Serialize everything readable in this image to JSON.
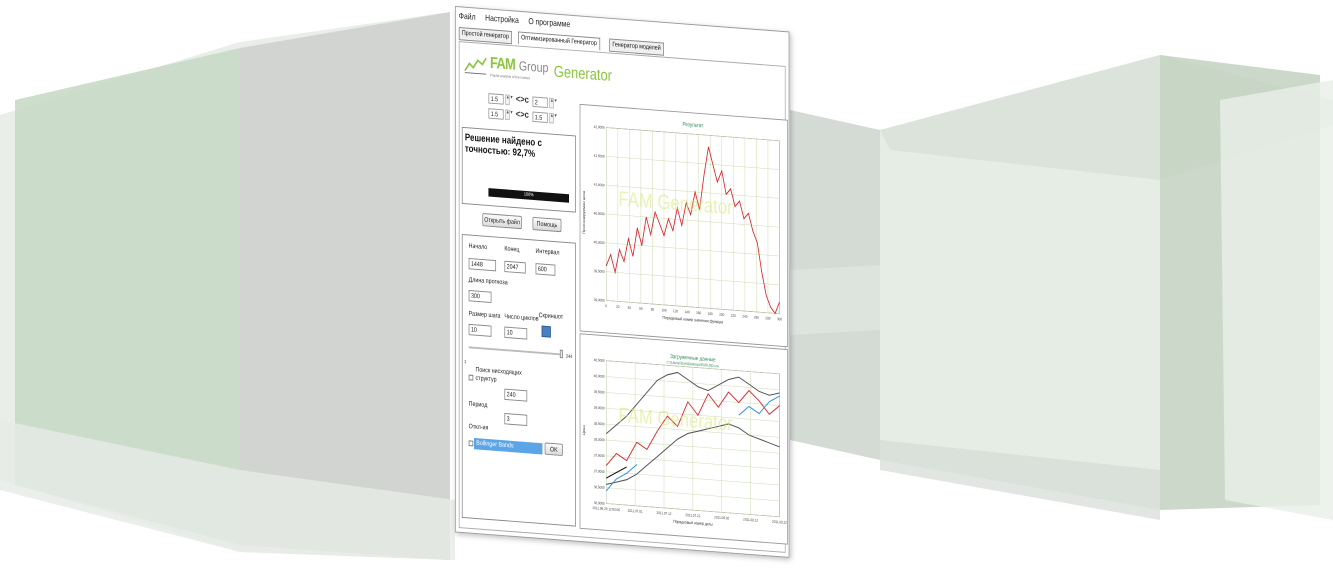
{
  "menu": {
    "file": "Файл",
    "settings": "Настройка",
    "about": "О программе"
  },
  "tabs": [
    {
      "label": "Простой генератор"
    },
    {
      "label": "Оптимизированный Генератор"
    },
    {
      "label": "Генератор моделей"
    }
  ],
  "logo": {
    "fam": "FAM",
    "group": "Group",
    "generator": "Generator",
    "tagline": "Fractal analysis of the market"
  },
  "spinners": [
    {
      "left": "1.5",
      "right": "2"
    },
    {
      "left": "1.5",
      "right": "1.5"
    }
  ],
  "result": {
    "text": "Решение найдено с точностью: 92,7%",
    "progress_label": "100%",
    "progress_value": 1.0
  },
  "buttons": {
    "open_file": "Открыть файл",
    "help": "Помощь",
    "ok": "OK"
  },
  "params": {
    "start_label": "Начало",
    "start_value": "1448",
    "end_label": "Конец",
    "end_value": "2047",
    "interval_label": "Интервал",
    "interval_value": "600",
    "forecast_label": "Длина прогноза",
    "forecast_value": "300",
    "step_label": "Размер шага",
    "step_value": "10",
    "cycles_label": "Число циклов",
    "cycles_value": "10",
    "screenshot_label": "Скриншот",
    "slider_min": "1",
    "slider_max": "244",
    "search_label": "Поиск нисходящих структур",
    "period_label": "Период",
    "period_value": "240",
    "deviation_label": "Откл-ия",
    "deviation_value": "3",
    "bollinger_label": "Bollinger Bands"
  },
  "chart_data": [
    {
      "type": "line",
      "title": "Результат",
      "xlabel": "Порядковый номер значения функции",
      "ylabel": "Прогнозируемая цена",
      "x_ticks": [
        "0",
        "20",
        "40",
        "60",
        "80",
        "100",
        "120",
        "140",
        "160",
        "180",
        "200",
        "220",
        "240",
        "260",
        "280",
        "300"
      ],
      "y_ticks": [
        "42,0000",
        "41,5000",
        "41,0000",
        "40,5000",
        "40,0000",
        "39,5000",
        "39,0000"
      ],
      "ylim": [
        39.0,
        42.0
      ],
      "xlim": [
        0,
        300
      ],
      "series": [
        {
          "color": "#d9262c",
          "values": [
            39.6,
            39.8,
            39.5,
            39.9,
            39.7,
            40.1,
            39.8,
            40.3,
            40.0,
            40.5,
            40.2,
            40.6,
            40.4,
            40.2,
            40.5,
            40.3,
            40.7,
            40.4,
            40.8,
            40.6,
            41.0,
            40.7,
            41.3,
            41.8,
            41.5,
            41.2,
            41.4,
            41.0,
            41.1,
            40.8,
            40.9,
            40.6,
            40.7,
            40.4,
            40.2,
            39.7,
            39.3,
            39.1,
            39.0,
            39.2
          ]
        }
      ],
      "watermark": "FAM Generator"
    },
    {
      "type": "line",
      "title": "Загруженные данные",
      "subtitle": "C:\\\\Users\\\\Dan\\\\Desktop\\\\EURUSD.csv",
      "xlabel": "Порядковый номер даты",
      "ylabel": "Цена",
      "y_ticks": [
        "40,5000",
        "40,0000",
        "39,5000",
        "39,0000",
        "38,5000",
        "38,0000",
        "37,5000",
        "37,0000",
        "36,5000",
        "36,0000"
      ],
      "x_ticks": [
        "2011.06.29 12:00:00",
        "2011.07.01",
        "2011.07.12",
        "2011.07.21",
        "2011.08.02",
        "2011.08.12",
        "2011.08.22"
      ],
      "ylim": [
        36.0,
        40.5
      ],
      "series": [
        {
          "name": "price",
          "color": "#d9262c",
          "values": [
            37.2,
            37.6,
            37.4,
            38.0,
            37.8,
            38.4,
            38.9,
            38.6,
            39.4,
            39.0,
            39.7,
            39.3,
            39.8,
            39.5,
            39.9,
            39.6,
            39.2,
            39.5
          ]
        },
        {
          "name": "upper",
          "color": "#555555",
          "values": [
            38.2,
            38.5,
            38.8,
            39.2,
            39.6,
            40.0,
            40.2,
            40.3,
            40.1,
            39.9,
            39.8,
            40.0,
            40.2,
            40.3,
            40.1,
            39.9,
            39.8,
            39.9
          ]
        },
        {
          "name": "lower",
          "color": "#555555",
          "values": [
            36.6,
            36.7,
            36.8,
            37.0,
            37.3,
            37.6,
            37.9,
            38.2,
            38.4,
            38.5,
            38.6,
            38.7,
            38.8,
            38.7,
            38.5,
            38.4,
            38.3,
            38.2
          ]
        },
        {
          "name": "forecast",
          "color": "#2b8ee0",
          "values": [
            null,
            null,
            null,
            null,
            null,
            null,
            null,
            null,
            null,
            null,
            null,
            null,
            null,
            39.1,
            39.4,
            39.2,
            39.6,
            39.8
          ]
        },
        {
          "name": "history",
          "color": "#2b8ee0",
          "values": [
            36.4,
            36.8,
            37.0,
            37.3,
            null,
            null,
            null,
            null,
            null,
            null,
            null,
            null,
            null,
            null,
            null,
            null,
            null,
            null
          ]
        },
        {
          "name": "tail",
          "color": "#111111",
          "values": [
            36.8,
            37.0,
            37.2,
            null,
            null,
            null,
            null,
            null,
            null,
            null,
            null,
            null,
            null,
            null,
            null,
            null,
            null,
            null
          ]
        }
      ],
      "watermark": "FAM Generator"
    }
  ]
}
